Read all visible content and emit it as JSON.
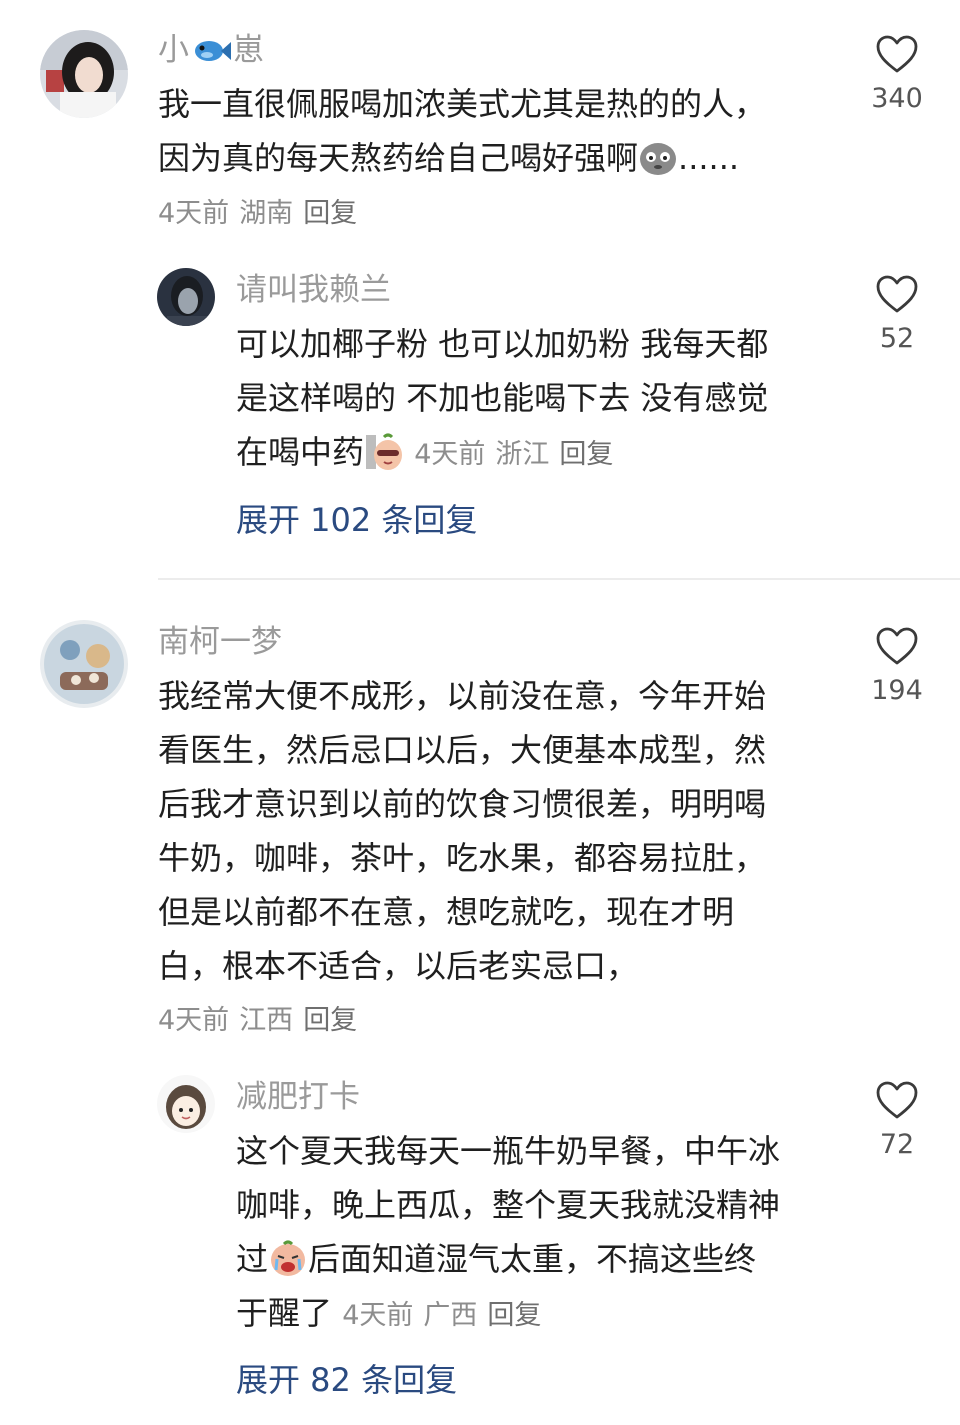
{
  "comments": [
    {
      "username_prefix": "小",
      "username_suffix": "崽",
      "name_emoji": "fish-emoji",
      "text_lines": [
        "我一直很佩服喝加浓美式尤其是热的的人，",
        "因为真的每天熬药给自己喝好强啊"
      ],
      "trailing": "......",
      "text_emoji": "sad-face-emoji",
      "time": "4天前",
      "location": "湖南",
      "reply_label": "回复",
      "likes": "340",
      "reply": {
        "username": "请叫我赖兰",
        "text_lines": [
          "可以加椰子粉 也可以加奶粉 我每天都",
          "是这样喝的 不加也能喝下去 没有感觉",
          "在喝中药"
        ],
        "text_emoji": "sunglasses-peach-emoji",
        "time": "4天前",
        "location": "浙江",
        "reply_label": "回复",
        "likes": "52"
      },
      "expand_label": "展开 102 条回复"
    },
    {
      "username": "南柯一梦",
      "text_lines": [
        "我经常大便不成形，以前没在意，今年开始",
        "看医生，然后忌口以后，大便基本成型，然",
        "后我才意识到以前的饮食习惯很差，明明喝",
        "牛奶，咖啡，茶叶，吃水果，都容易拉肚，",
        "但是以前都不在意，想吃就吃，现在才明",
        "白，根本不适合，以后老实忌口，"
      ],
      "time": "4天前",
      "location": "江西",
      "reply_label": "回复",
      "likes": "194",
      "reply": {
        "username": "减肥打卡",
        "text_lines": [
          "这个夏天我每天一瓶牛奶早餐，中午冰",
          "咖啡，晚上西瓜，整个夏天我就没精神",
          "后面知道湿气太重，不搞这些终",
          "于醒了"
        ],
        "line3_prefix": "过",
        "text_emoji": "crying-peach-emoji",
        "time": "4天前",
        "location": "广西",
        "reply_label": "回复",
        "likes": "72"
      },
      "expand_label": "展开 82 条回复"
    }
  ],
  "colors": {
    "username": "#9a9a9a",
    "text": "#1f1f1f",
    "meta": "#8d8d8d",
    "expand_link": "#2a4a80",
    "divider": "#ececec"
  },
  "icons": {
    "like": "heart-outline-icon"
  }
}
